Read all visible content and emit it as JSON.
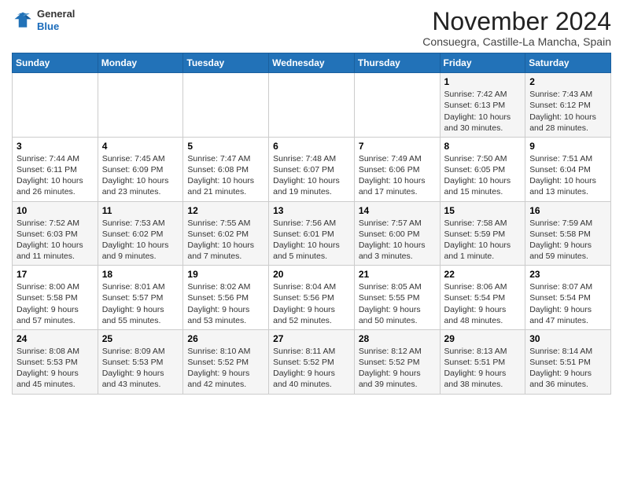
{
  "header": {
    "logo_line1": "General",
    "logo_line2": "Blue",
    "month": "November 2024",
    "location": "Consuegra, Castille-La Mancha, Spain"
  },
  "days_of_week": [
    "Sunday",
    "Monday",
    "Tuesday",
    "Wednesday",
    "Thursday",
    "Friday",
    "Saturday"
  ],
  "weeks": [
    [
      {
        "day": "",
        "info": ""
      },
      {
        "day": "",
        "info": ""
      },
      {
        "day": "",
        "info": ""
      },
      {
        "day": "",
        "info": ""
      },
      {
        "day": "",
        "info": ""
      },
      {
        "day": "1",
        "info": "Sunrise: 7:42 AM\nSunset: 6:13 PM\nDaylight: 10 hours\nand 30 minutes."
      },
      {
        "day": "2",
        "info": "Sunrise: 7:43 AM\nSunset: 6:12 PM\nDaylight: 10 hours\nand 28 minutes."
      }
    ],
    [
      {
        "day": "3",
        "info": "Sunrise: 7:44 AM\nSunset: 6:11 PM\nDaylight: 10 hours\nand 26 minutes."
      },
      {
        "day": "4",
        "info": "Sunrise: 7:45 AM\nSunset: 6:09 PM\nDaylight: 10 hours\nand 23 minutes."
      },
      {
        "day": "5",
        "info": "Sunrise: 7:47 AM\nSunset: 6:08 PM\nDaylight: 10 hours\nand 21 minutes."
      },
      {
        "day": "6",
        "info": "Sunrise: 7:48 AM\nSunset: 6:07 PM\nDaylight: 10 hours\nand 19 minutes."
      },
      {
        "day": "7",
        "info": "Sunrise: 7:49 AM\nSunset: 6:06 PM\nDaylight: 10 hours\nand 17 minutes."
      },
      {
        "day": "8",
        "info": "Sunrise: 7:50 AM\nSunset: 6:05 PM\nDaylight: 10 hours\nand 15 minutes."
      },
      {
        "day": "9",
        "info": "Sunrise: 7:51 AM\nSunset: 6:04 PM\nDaylight: 10 hours\nand 13 minutes."
      }
    ],
    [
      {
        "day": "10",
        "info": "Sunrise: 7:52 AM\nSunset: 6:03 PM\nDaylight: 10 hours\nand 11 minutes."
      },
      {
        "day": "11",
        "info": "Sunrise: 7:53 AM\nSunset: 6:02 PM\nDaylight: 10 hours\nand 9 minutes."
      },
      {
        "day": "12",
        "info": "Sunrise: 7:55 AM\nSunset: 6:02 PM\nDaylight: 10 hours\nand 7 minutes."
      },
      {
        "day": "13",
        "info": "Sunrise: 7:56 AM\nSunset: 6:01 PM\nDaylight: 10 hours\nand 5 minutes."
      },
      {
        "day": "14",
        "info": "Sunrise: 7:57 AM\nSunset: 6:00 PM\nDaylight: 10 hours\nand 3 minutes."
      },
      {
        "day": "15",
        "info": "Sunrise: 7:58 AM\nSunset: 5:59 PM\nDaylight: 10 hours\nand 1 minute."
      },
      {
        "day": "16",
        "info": "Sunrise: 7:59 AM\nSunset: 5:58 PM\nDaylight: 9 hours\nand 59 minutes."
      }
    ],
    [
      {
        "day": "17",
        "info": "Sunrise: 8:00 AM\nSunset: 5:58 PM\nDaylight: 9 hours\nand 57 minutes."
      },
      {
        "day": "18",
        "info": "Sunrise: 8:01 AM\nSunset: 5:57 PM\nDaylight: 9 hours\nand 55 minutes."
      },
      {
        "day": "19",
        "info": "Sunrise: 8:02 AM\nSunset: 5:56 PM\nDaylight: 9 hours\nand 53 minutes."
      },
      {
        "day": "20",
        "info": "Sunrise: 8:04 AM\nSunset: 5:56 PM\nDaylight: 9 hours\nand 52 minutes."
      },
      {
        "day": "21",
        "info": "Sunrise: 8:05 AM\nSunset: 5:55 PM\nDaylight: 9 hours\nand 50 minutes."
      },
      {
        "day": "22",
        "info": "Sunrise: 8:06 AM\nSunset: 5:54 PM\nDaylight: 9 hours\nand 48 minutes."
      },
      {
        "day": "23",
        "info": "Sunrise: 8:07 AM\nSunset: 5:54 PM\nDaylight: 9 hours\nand 47 minutes."
      }
    ],
    [
      {
        "day": "24",
        "info": "Sunrise: 8:08 AM\nSunset: 5:53 PM\nDaylight: 9 hours\nand 45 minutes."
      },
      {
        "day": "25",
        "info": "Sunrise: 8:09 AM\nSunset: 5:53 PM\nDaylight: 9 hours\nand 43 minutes."
      },
      {
        "day": "26",
        "info": "Sunrise: 8:10 AM\nSunset: 5:52 PM\nDaylight: 9 hours\nand 42 minutes."
      },
      {
        "day": "27",
        "info": "Sunrise: 8:11 AM\nSunset: 5:52 PM\nDaylight: 9 hours\nand 40 minutes."
      },
      {
        "day": "28",
        "info": "Sunrise: 8:12 AM\nSunset: 5:52 PM\nDaylight: 9 hours\nand 39 minutes."
      },
      {
        "day": "29",
        "info": "Sunrise: 8:13 AM\nSunset: 5:51 PM\nDaylight: 9 hours\nand 38 minutes."
      },
      {
        "day": "30",
        "info": "Sunrise: 8:14 AM\nSunset: 5:51 PM\nDaylight: 9 hours\nand 36 minutes."
      }
    ]
  ]
}
